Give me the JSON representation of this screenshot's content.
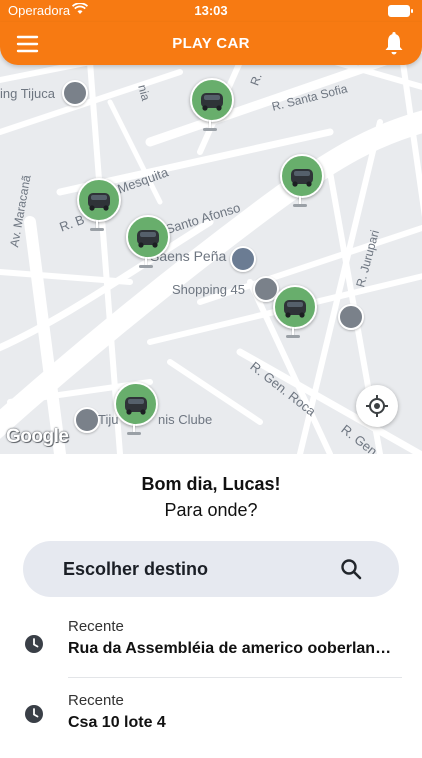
{
  "status_bar": {
    "carrier": "Operadora",
    "time": "13:03"
  },
  "header": {
    "title": "PLAY CAR",
    "menu_icon": "hamburger-menu-icon",
    "notification_icon": "bell-icon"
  },
  "map": {
    "streets": [
      "R. Santa Sofia",
      "R. Santo Afonso",
      "Mesquita",
      "R. B",
      "Av. Maracanã",
      "R. Jurupari",
      "R. Gen. Roca",
      "R. Gen. Roc",
      "nia",
      "R."
    ],
    "places": [
      "ing Tijuca",
      "Saens Peña",
      "Shopping 45",
      "Tiju",
      "nis Clube"
    ],
    "attribution": "Google",
    "car_color": "#68ae6c",
    "locate_icon": "crosshair-locate-icon"
  },
  "panel": {
    "greeting": "Bom dia, Lucas!",
    "question": "Para onde?",
    "search": {
      "placeholder": "Escolher destino",
      "icon": "search-icon"
    },
    "recents": [
      {
        "label": "Recente",
        "address": "Rua da Assembléia de americo ooberlan…"
      },
      {
        "label": "Recente",
        "address": "Csa 10 lote 4"
      }
    ]
  },
  "colors": {
    "brand_orange": "#f77a12",
    "map_bg": "#e9ebee",
    "search_bg": "#e6e9f0"
  }
}
